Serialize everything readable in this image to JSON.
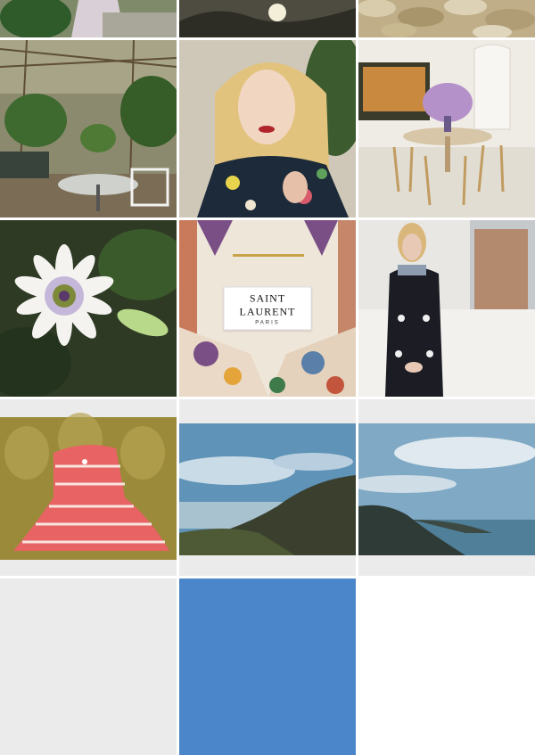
{
  "feed": {
    "posts": [
      {
        "subject": "garden dining with dress"
      },
      {
        "subject": "town sunset"
      },
      {
        "subject": "stone wall"
      },
      {
        "subject": "pergola garden terrace"
      },
      {
        "subject": "blonde woman in floral blouse"
      },
      {
        "subject": "dining room with flowers"
      },
      {
        "subject": "passion flower"
      },
      {
        "subject": "floral garment label"
      },
      {
        "subject": "woman in black dress by window"
      },
      {
        "subject": "striped dress on gold damask"
      },
      {
        "subject": "coastal cliff view"
      },
      {
        "subject": "coastline and sea"
      },
      {
        "subject": "blank"
      },
      {
        "subject": "blue sky"
      },
      {
        "subject": "blank"
      }
    ],
    "label": {
      "brand": "SAINT LAURENT",
      "city": "PARIS"
    }
  }
}
